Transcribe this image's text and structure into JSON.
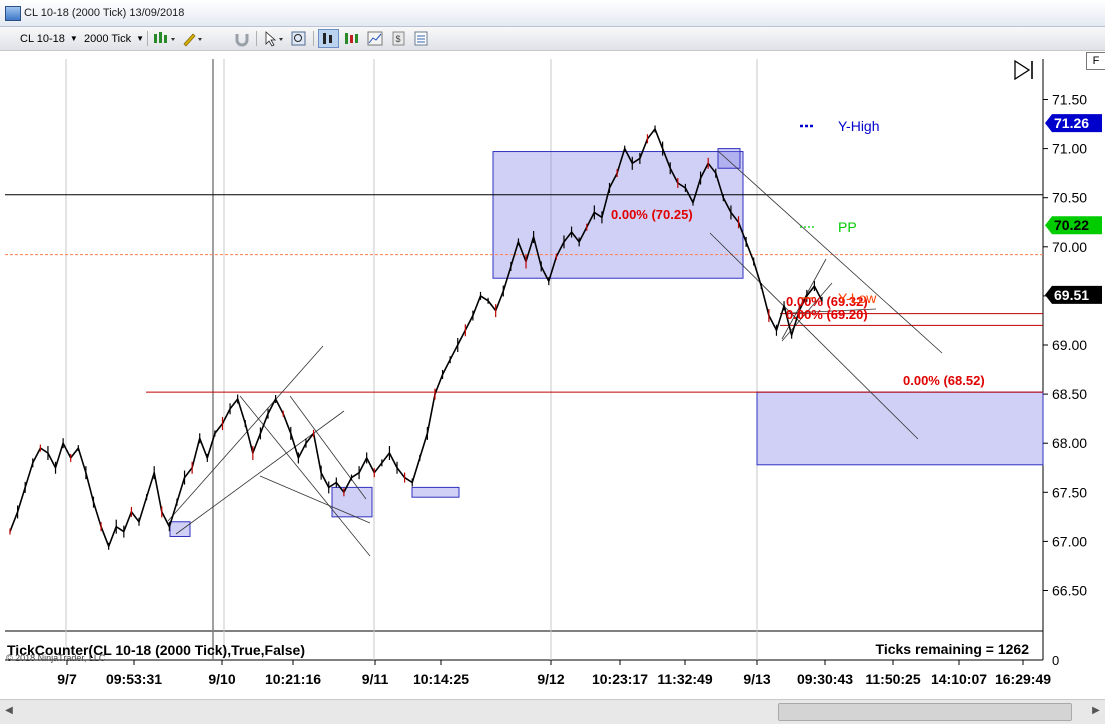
{
  "window": {
    "title": "CL 10-18 (2000 Tick)  13/09/2018"
  },
  "toolbar": {
    "instrument": "CL 10-18",
    "period": "2000 Tick"
  },
  "panel": {
    "f_label": "F"
  },
  "chart_data": {
    "type": "line",
    "instrument": "CL 10-18",
    "period": "2000 Tick",
    "y_ticks": [
      "71.50",
      "71.00",
      "70.50",
      "70.00",
      "69.50",
      "69.00",
      "68.50",
      "68.00",
      "67.50",
      "67.00",
      "66.50"
    ],
    "ylim": [
      66.5,
      71.5
    ],
    "x_ticks": [
      "9/7",
      "09:53:31",
      "9/10",
      "10:21:16",
      "9/11",
      "10:14:25",
      "9/12",
      "10:23:17",
      "11:32:49",
      "9/13",
      "09:30:43",
      "11:50:25",
      "14:10:07",
      "16:29:49"
    ],
    "price_series": {
      "name": "CL 10-18",
      "values": [
        67.1,
        67.3,
        67.55,
        67.8,
        67.95,
        67.9,
        67.75,
        68.0,
        67.85,
        67.95,
        67.7,
        67.4,
        67.15,
        66.95,
        67.15,
        67.1,
        67.3,
        67.2,
        67.45,
        67.7,
        67.3,
        67.15,
        67.4,
        67.65,
        67.75,
        68.05,
        67.85,
        68.1,
        68.2,
        68.35,
        68.45,
        68.2,
        67.9,
        68.1,
        68.3,
        68.45,
        68.3,
        68.1,
        67.85,
        68.0,
        68.1,
        67.7,
        67.55,
        67.6,
        67.5,
        67.65,
        67.7,
        67.85,
        67.7,
        67.8,
        67.9,
        67.75,
        67.65,
        67.6,
        67.85,
        68.1,
        68.5,
        68.7,
        68.85,
        69.0,
        69.15,
        69.3,
        69.5,
        69.45,
        69.35,
        69.55,
        69.8,
        70.05,
        69.85,
        70.1,
        69.8,
        69.65,
        69.9,
        70.05,
        70.15,
        70.05,
        70.2,
        70.35,
        70.3,
        70.6,
        70.75,
        71.0,
        70.85,
        70.9,
        71.1,
        71.2,
        71.0,
        70.8,
        70.65,
        70.6,
        70.45,
        70.7,
        70.85,
        70.75,
        70.5,
        70.35,
        70.25,
        70.05,
        69.85,
        69.6,
        69.3,
        69.15,
        69.4,
        69.1,
        69.35,
        69.5,
        69.6,
        69.45
      ]
    },
    "horizontal_levels": [
      {
        "y": 70.53,
        "color": "#000000"
      },
      {
        "y": 69.92,
        "color": "#ff7f50",
        "style": "dashed"
      },
      {
        "y": 69.32,
        "color": "#c00000"
      },
      {
        "y": 69.2,
        "color": "#c00000"
      },
      {
        "y": 68.52,
        "color": "#c00000"
      }
    ],
    "zones": [
      {
        "y_top": 70.97,
        "y_bottom": 69.68
      },
      {
        "y_top": 68.52,
        "y_bottom": 67.78
      },
      {
        "y_top": 67.55,
        "y_bottom": 67.25
      },
      {
        "y_top": 67.55,
        "y_bottom": 67.45
      },
      {
        "y_top": 67.2,
        "y_bottom": 67.05
      },
      {
        "y_top": 71.0,
        "y_bottom": 70.8
      }
    ],
    "annotations": [
      {
        "text": "0.00% (70.25)",
        "color": "#e00000"
      },
      {
        "text": "0.00% (69.32)",
        "color": "#e00000"
      },
      {
        "text": "0.00% (69.20)",
        "color": "#e00000"
      },
      {
        "text": "0.00% (68.52)",
        "color": "#e00000"
      }
    ],
    "legend": [
      {
        "name": "Y-High",
        "color": "#0000cc"
      },
      {
        "name": "PP",
        "color": "#00cc00"
      },
      {
        "name": "Y-Low",
        "color": "#ff4000"
      }
    ],
    "price_markers": [
      {
        "value": "71.26",
        "bg": "#0000cc",
        "fg": "#ffffff"
      },
      {
        "value": "70.22",
        "bg": "#00cc00",
        "fg": "#000000"
      },
      {
        "value": "69.51",
        "bg": "#000000",
        "fg": "#ffffff"
      }
    ],
    "indicator": {
      "label": "TickCounter(CL 10-18 (2000 Tick),True,False)",
      "ticks_remaining": "Ticks remaining = 1262",
      "axis_value": "0"
    },
    "copyright": "© 2018 NinjaTrader, LLC"
  }
}
